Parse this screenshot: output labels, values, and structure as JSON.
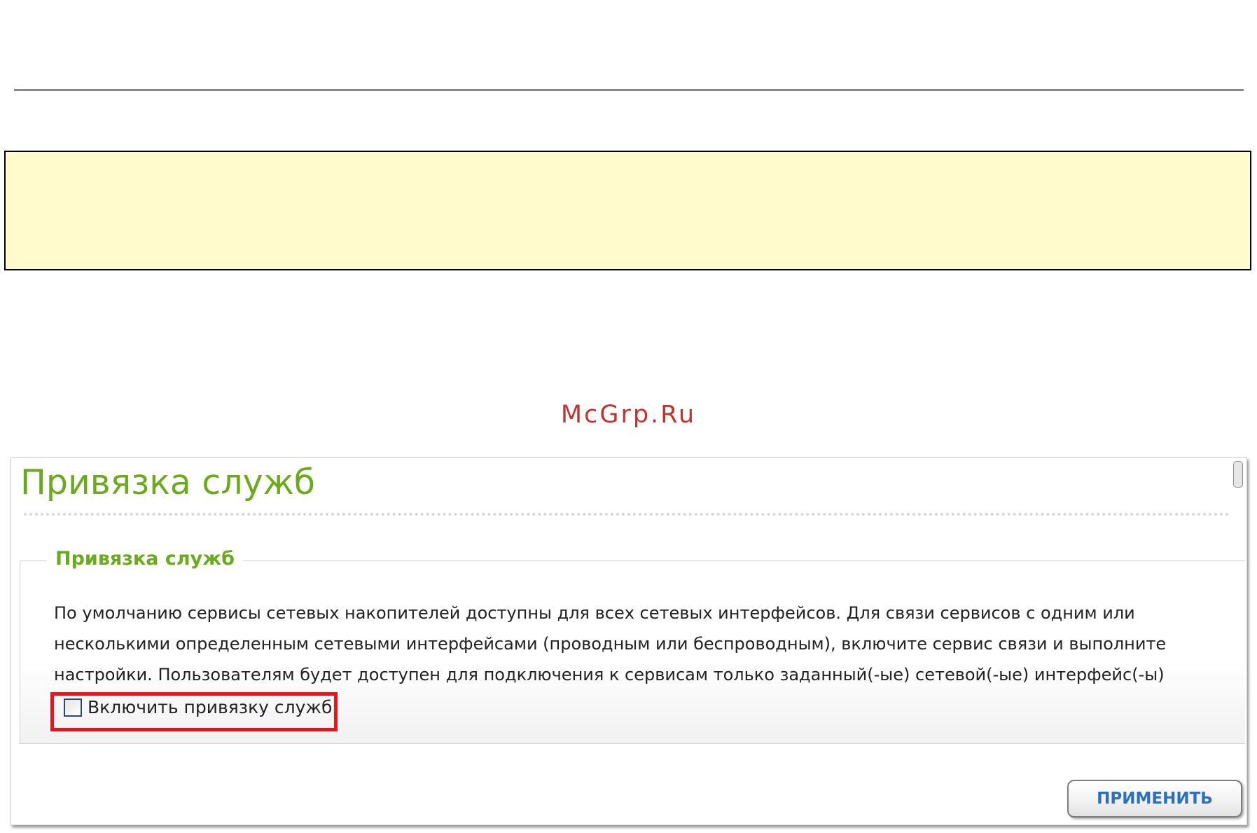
{
  "watermark": "McGrp.Ru",
  "page": {
    "title": "Привязка служб"
  },
  "section": {
    "legend": "Привязка служб",
    "description_lines": [
      "По умолчанию сервисы сетевых накопителей доступны для всех сетевых интерфейсов. Для связи сервисов с одним или",
      "несколькими определенным сетевыми интерфейсами (проводным или беспроводным), включите сервис связи и выполните",
      "настройки. Пользователям будет доступен для подключения к сервисам только заданный(-ые) сетевой(-ые) интерфейс(-ы)"
    ],
    "checkbox": {
      "label": "Включить привязку служб",
      "checked": false
    }
  },
  "buttons": {
    "apply_label": "ПРИМЕНИТЬ"
  },
  "colors": {
    "title_green": "#6aaa1c",
    "highlight_red": "#e8141b",
    "button_text_blue": "#2b6fbf",
    "note_background": "#fffbcd",
    "watermark_red": "#c0332f"
  }
}
